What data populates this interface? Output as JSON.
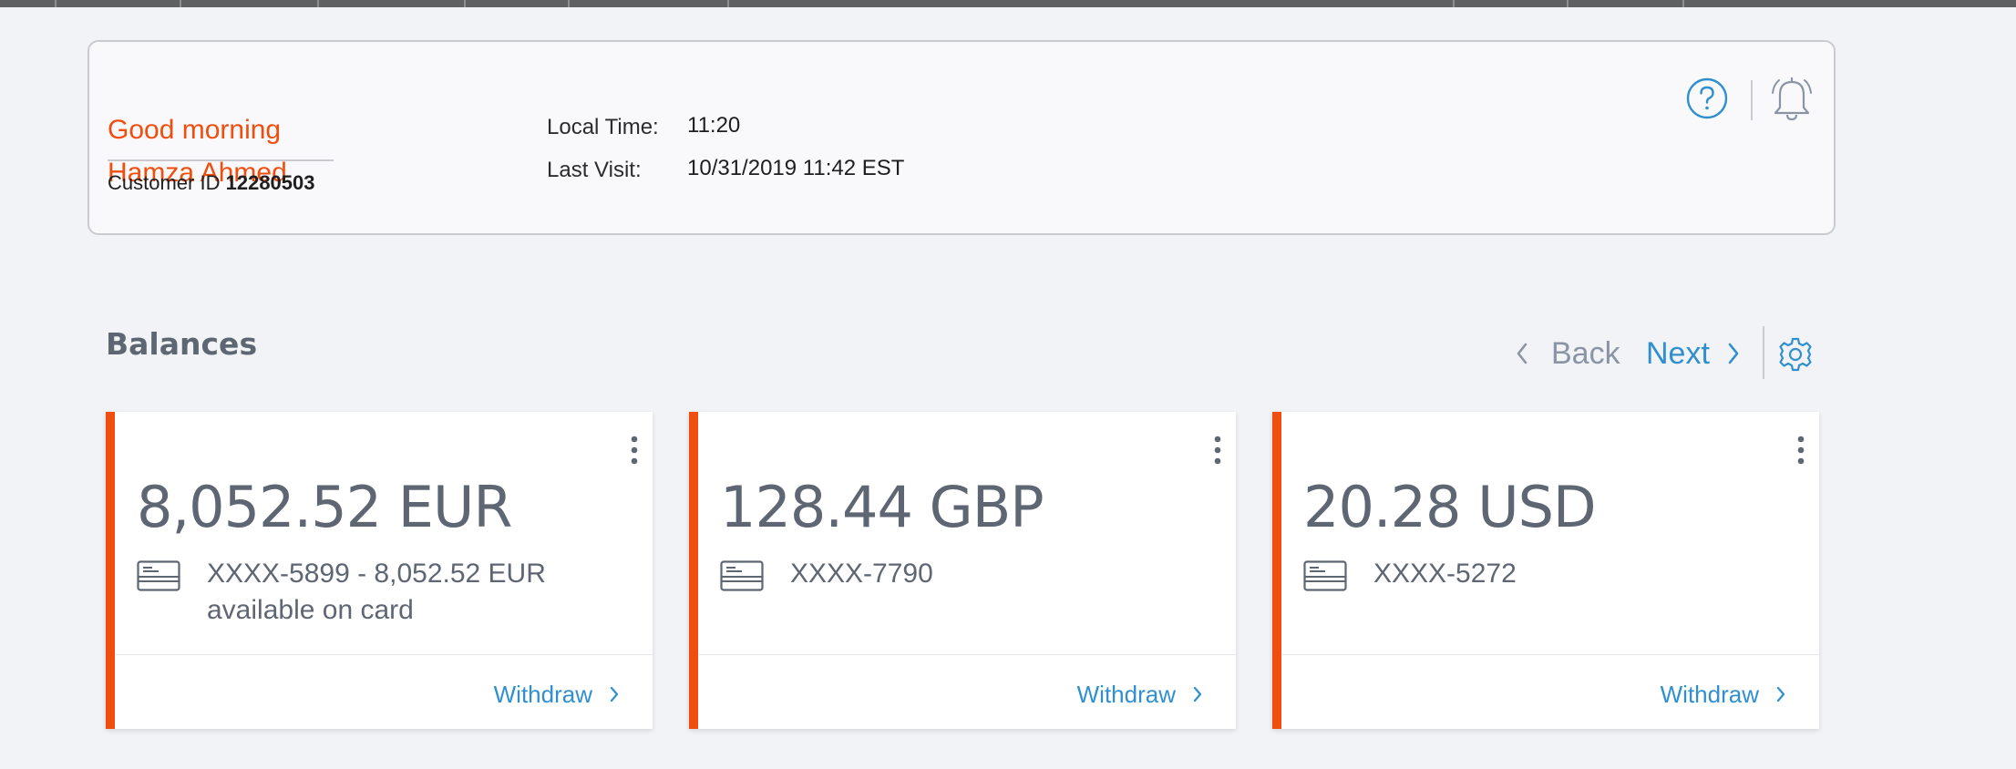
{
  "header": {
    "greeting": "Good morning",
    "user_name": "Hamza Ahmed",
    "customer_id_label": "Customer ID",
    "customer_id": "12280503",
    "local_time_label": "Local Time:",
    "local_time": "11:20",
    "last_visit_label": "Last Visit:",
    "last_visit": "10/31/2019 11:42 EST",
    "icons": [
      "help-icon",
      "bell-icon"
    ]
  },
  "balances": {
    "title": "Balances",
    "back_label": "Back",
    "next_label": "Next",
    "icons": [
      "chevron-left-icon",
      "chevron-right-icon",
      "gear-icon"
    ],
    "cards": [
      {
        "amount": "8,052.52 EUR",
        "account": "XXXX-5899 - 8,052.52 EUR available on card",
        "action": "Withdraw"
      },
      {
        "amount": "128.44 GBP",
        "account": "XXXX-7790",
        "action": "Withdraw"
      },
      {
        "amount": "20.28 USD",
        "account": "XXXX-5272",
        "action": "Withdraw"
      }
    ]
  },
  "colors": {
    "accent": "#f04e0f",
    "link": "#2f8fcf",
    "muted_text": "#5f6673",
    "background": "#f2f3f6"
  }
}
